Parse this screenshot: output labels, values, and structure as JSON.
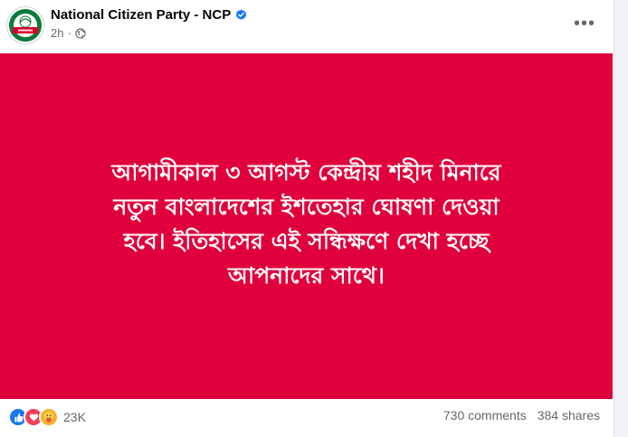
{
  "post": {
    "page_name": "National Citizen Party - NCP",
    "time": "2h",
    "verified_icon": "verified-badge-icon",
    "privacy_icon": "globe-icon",
    "more_icon": "more-options-icon",
    "image": {
      "background_color": "#e0003c",
      "text_line_1": "আগামীকাল ৩ আগস্ট কেন্দ্রীয় শহীদ মিনারে",
      "text_line_2": "নতুন বাংলাদেশের ইশতেহার ঘোষণা দেওয়া",
      "text_line_3": "হবে। ইতিহাসের এই সন্ধিক্ষণে দেখা হচ্ছে",
      "text_line_4": "আপনাদের সাথে।"
    },
    "logo": {
      "lettering": "জাতীয় নাগরিক পার্টি",
      "ring_color": "#0b7a3b",
      "band_color": "#d6002a"
    }
  },
  "stats": {
    "reaction_icons": [
      "like-icon",
      "love-icon",
      "care-icon"
    ],
    "reaction_count": "23K",
    "comments": "730 comments",
    "shares": "384 shares"
  },
  "colors": {
    "primary_text": "#050505",
    "secondary_text": "#65676b",
    "verified_blue": "#1877f2"
  }
}
